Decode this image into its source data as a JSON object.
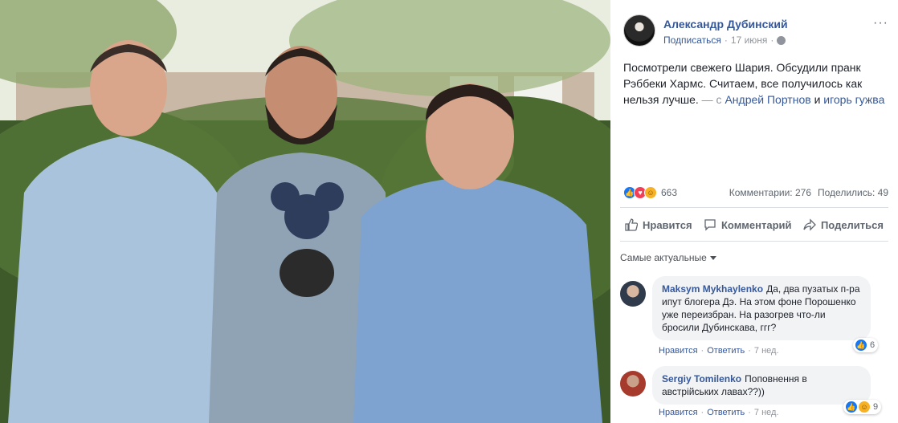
{
  "post": {
    "author": "Александр Дубинский",
    "subscribe": "Подписаться",
    "date": "17 июня",
    "more": "···",
    "text_main": "Посмотрели свежего Шария. Обсудили пранк Рэббеки Хармс. Считаем, все получилось как нельзя лучше.",
    "text_with": "— с",
    "tag1": "Андрей Портнов",
    "text_and": "и",
    "tag2": "игорь гужва",
    "reactions_count": "663",
    "comments_count": "Комментарии: 276",
    "shares_count": "Поделились: 49"
  },
  "actions": {
    "like": "Нравится",
    "comment": "Комментарий",
    "share": "Поделиться"
  },
  "sort_label": "Самые актуальные",
  "comments": [
    {
      "name": "Maksym Mykhaylenko",
      "text": "Да, два пузатых п-ра ипут блогера Дэ. На этом фоне Порошенко уже переизбран. На разогрев что-ли бросили Дубинскава, ггг?",
      "like": "Нравится",
      "reply": "Ответить",
      "time": "7 нед.",
      "reactions": "6"
    },
    {
      "name": "Sergiy Tomilenko",
      "text": "Поповнення в австрійських лавах??))",
      "like": "Нравится",
      "reply": "Ответить",
      "time": "7 нед.",
      "reactions": "9"
    }
  ],
  "icons": {
    "like": "thumbs-up-icon",
    "comment": "speech-bubble-icon",
    "share": "share-arrow-icon",
    "privacy": "globe-icon",
    "sort": "chevron-down-icon"
  },
  "colors": {
    "link": "#365899",
    "like_blue": "#1877f2",
    "love_red": "#f33e58",
    "haha_yellow": "#f7b125",
    "bubble_bg": "#f2f3f5"
  }
}
